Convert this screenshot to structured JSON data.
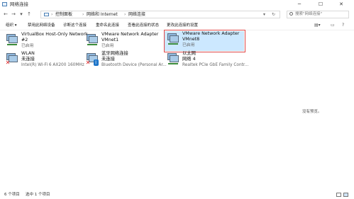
{
  "window": {
    "title": "网络连接"
  },
  "address": {
    "crumbs": [
      "控制面板",
      "网络和 Internet",
      "网络连接"
    ],
    "search_placeholder": "搜索\"网络连接\""
  },
  "toolbar": {
    "items": [
      "组织 ▾",
      "禁用此网络设备",
      "诊断这个连接",
      "重命名此连接",
      "查看此连接的状态",
      "更改此连接的设置"
    ]
  },
  "adapters": [
    {
      "name": "VirtualBox Host-Only Network",
      "line2": "#2",
      "status": "已启用",
      "icon": "network-adapter-icon"
    },
    {
      "name": "VMware Network Adapter",
      "line2": "VMnet1",
      "status": "已启用",
      "icon": "network-adapter-icon"
    },
    {
      "name": "VMware Network Adapter",
      "line2": "VMnet8",
      "status": "已启用",
      "icon": "network-adapter-icon",
      "selected": true
    },
    {
      "name": "WLAN",
      "line2": "未连接",
      "status": "Intel(R) Wi-Fi 6 AX200 160MHz",
      "icon": "wifi-adapter-icon",
      "disconnected": true
    },
    {
      "name": "蓝牙网络连接",
      "line2": "未连接",
      "status": "Bluetooth Device (Personal Ar...",
      "icon": "bluetooth-adapter-icon",
      "disconnected": true
    },
    {
      "name": "以太网",
      "line2": "网络 4",
      "status": "Realtek PCIe GbE Family Contr...",
      "icon": "ethernet-adapter-icon"
    }
  ],
  "preview_text": "没有预览。",
  "statusbar": {
    "count": "6 个项目",
    "selected": "选中 1 个项目"
  },
  "colors": {
    "selection": "#cce8ff",
    "highlight_border": "#e04848"
  }
}
